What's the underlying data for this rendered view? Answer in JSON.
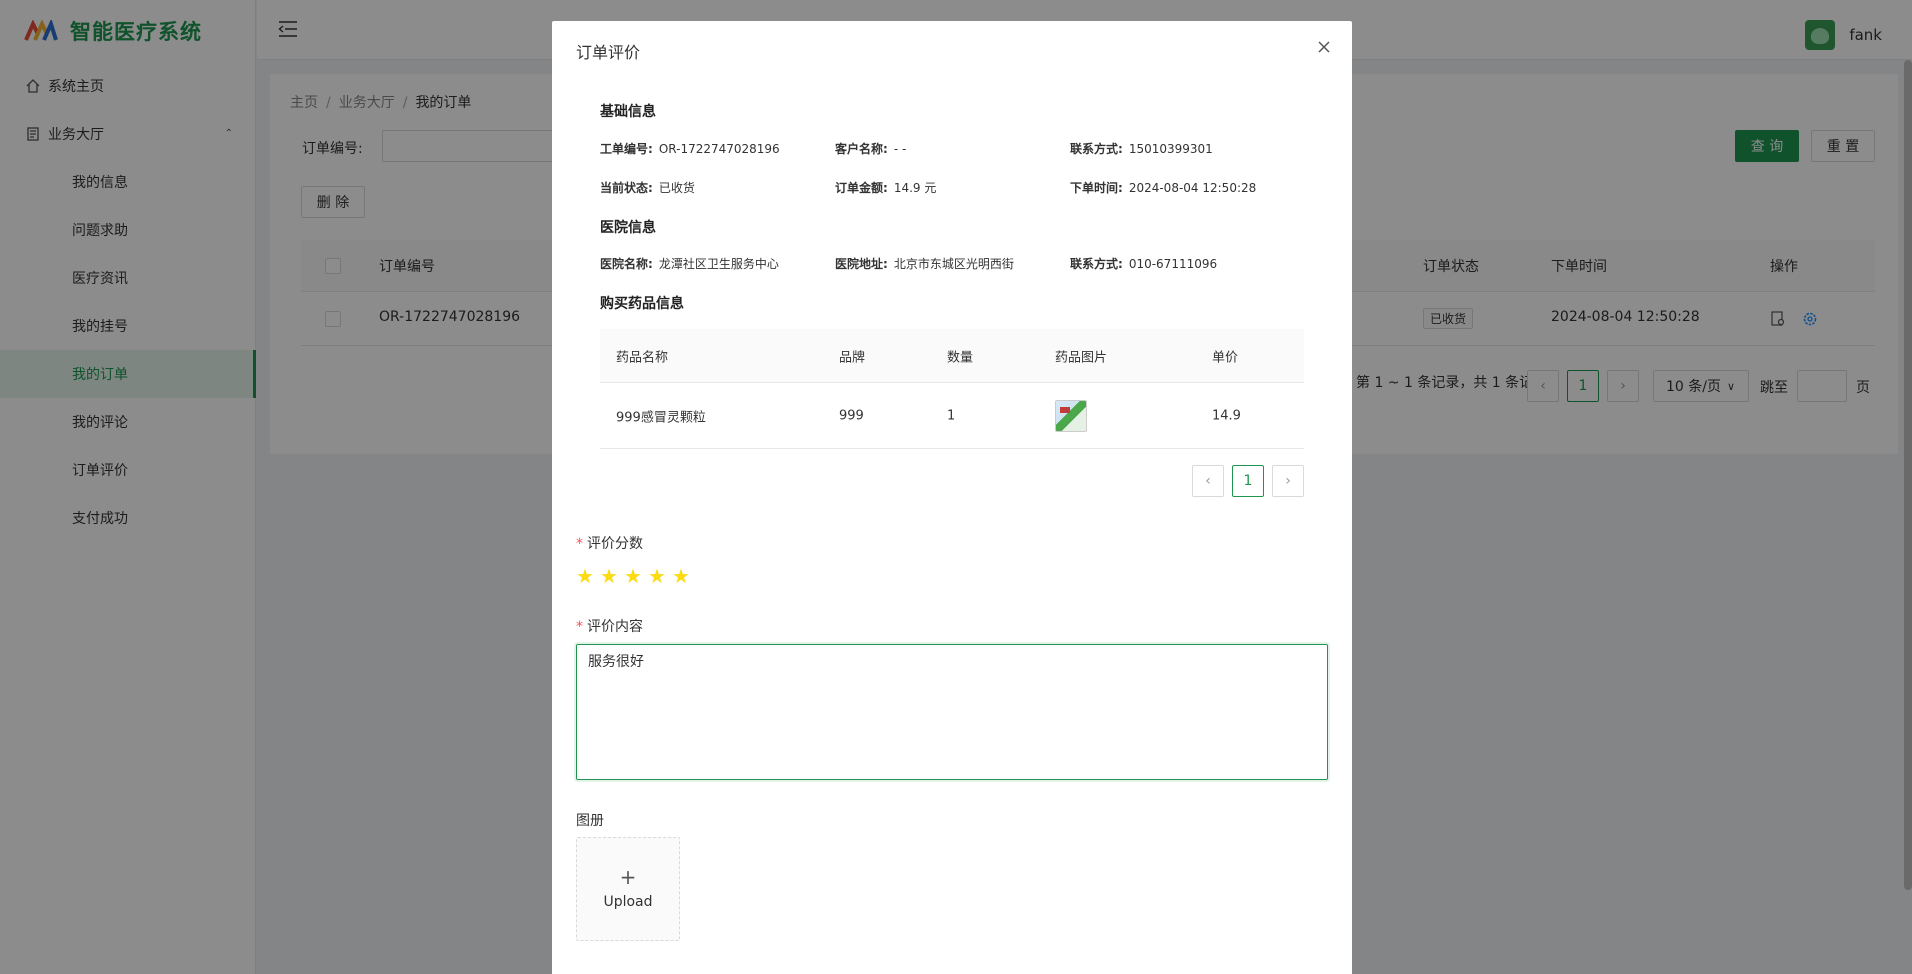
{
  "app": {
    "name": "智能医疗系统",
    "username": "fank"
  },
  "sidebar": {
    "home": "系统主页",
    "group": "业务大厅",
    "items": [
      {
        "label": "我的信息"
      },
      {
        "label": "问题求助"
      },
      {
        "label": "医疗资讯"
      },
      {
        "label": "我的挂号"
      },
      {
        "label": "我的订单",
        "active": true
      },
      {
        "label": "我的评论"
      },
      {
        "label": "订单评价"
      },
      {
        "label": "支付成功"
      }
    ]
  },
  "breadcrumb": [
    "主页",
    "业务大厅",
    "我的订单"
  ],
  "search": {
    "label": "订单编号:",
    "value": ""
  },
  "buttons": {
    "query": "查 询",
    "reset": "重 置",
    "delete": "删 除"
  },
  "orders_table": {
    "headers": [
      "订单编号",
      "订单状态",
      "下单时间",
      "操作"
    ],
    "rows": [
      {
        "order_no": "OR-1722747028196",
        "status": "已收货",
        "time": "2024-08-04 12:50:28"
      }
    ]
  },
  "pagination": {
    "total_text": "第 1 ~ 1 条记录，共 1 条记录",
    "current": "1",
    "page_size": "10 条/页",
    "jump_label": "跳至",
    "jump_suffix": "页"
  },
  "modal": {
    "title": "订单评价",
    "basic": {
      "title": "基础信息",
      "order_no_label": "工单编号:",
      "order_no": "OR-1722747028196",
      "customer_label": "客户名称:",
      "customer": "- -",
      "contact_label": "联系方式:",
      "contact": "15010399301",
      "status_label": "当前状态:",
      "status": "已收货",
      "amount_label": "订单金额:",
      "amount": "14.9 元",
      "time_label": "下单时间:",
      "time": "2024-08-04 12:50:28"
    },
    "hospital": {
      "title": "医院信息",
      "name_label": "医院名称:",
      "name": "龙潭社区卫生服务中心",
      "address_label": "医院地址:",
      "address": "北京市东城区光明西街",
      "contact_label": "联系方式:",
      "contact": "010-67111096"
    },
    "drugs": {
      "title": "购买药品信息",
      "headers": [
        "药品名称",
        "品牌",
        "数量",
        "药品图片",
        "单价"
      ],
      "rows": [
        {
          "name": "999感冒灵颗粒",
          "brand": "999",
          "qty": "1",
          "price": "14.9"
        }
      ],
      "page": "1"
    },
    "rating": {
      "label": "评价分数",
      "stars": 5
    },
    "content": {
      "label": "评价内容",
      "value": "服务很好"
    },
    "album": {
      "label": "图册",
      "upload": "Upload"
    }
  },
  "colors": {
    "accent": "#1e9650",
    "star": "#fadb14",
    "required": "#ff4d4f"
  }
}
